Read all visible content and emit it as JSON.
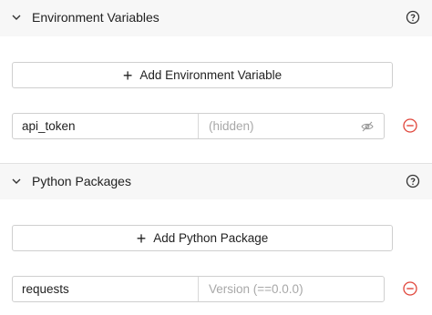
{
  "env_section": {
    "title": "Environment Variables",
    "add_label": "Add Environment Variable",
    "rows": [
      {
        "name": "api_token",
        "value_placeholder": "(hidden)"
      }
    ]
  },
  "packages_section": {
    "title": "Python Packages",
    "add_label": "Add Python Package",
    "rows": [
      {
        "name": "requests",
        "version_placeholder": "Version (==0.0.0)"
      }
    ]
  },
  "icons": {
    "collapse": "chevron-down-icon",
    "help": "help-circle-icon",
    "add": "plus-icon",
    "visibility": "eye-off-icon",
    "remove": "minus-circle-icon"
  },
  "colors": {
    "remove": "#e0453a",
    "header_bg": "#f7f7f7",
    "border": "#cfcfcf"
  }
}
